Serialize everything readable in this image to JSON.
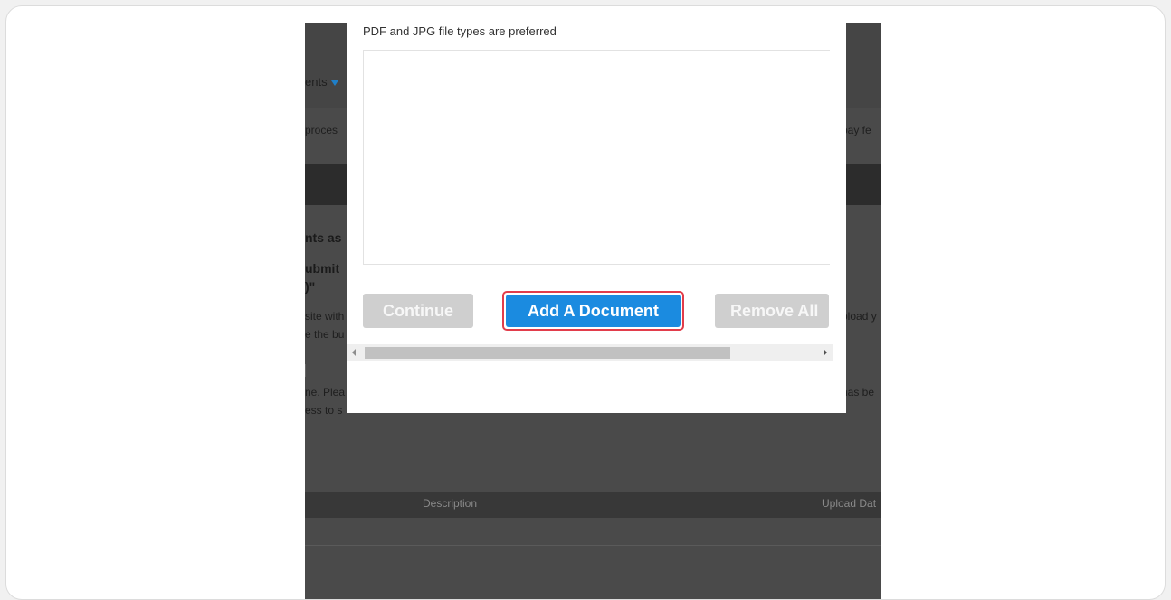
{
  "background_page": {
    "nav_menu_fragment": "ents",
    "notice_left": "proces",
    "notice_right": "pay fe",
    "section_heading": "nts as",
    "sub_heading_line1": "ubmit",
    "sub_heading_line2": ")\"",
    "para1_line1": "site with",
    "para1_line2": "e the bu",
    "para1_right": "pload y",
    "para2_line1": "ne. Plea",
    "para2_line2": "ess to s",
    "para2_right": "has be",
    "table_headers": [
      "Description",
      "Upload Dat"
    ]
  },
  "dialog": {
    "hint": "PDF and JPG file types are preferred",
    "buttons": {
      "continue": "Continue",
      "add_document": "Add A Document",
      "remove_all": "Remove All"
    }
  },
  "colors": {
    "primary": "#1b8be0",
    "focus_ring": "#e23d4b",
    "disabled": "#cfcfcf"
  }
}
